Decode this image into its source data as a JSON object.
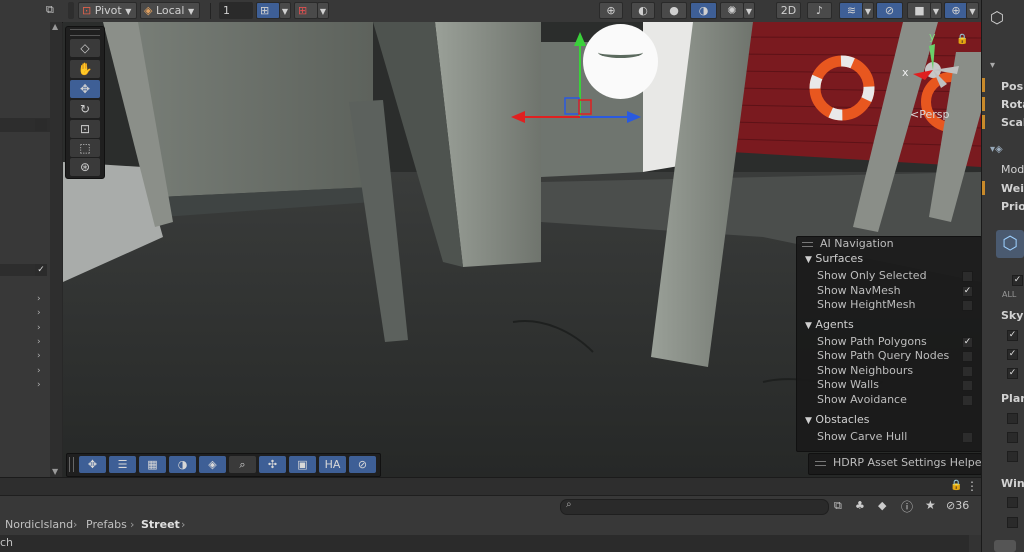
{
  "toolbar": {
    "pivot_label": "Pivot",
    "local_label": "Local",
    "grid_value": "1",
    "mode_2d": "2D"
  },
  "overlays": {
    "ai_navigation": {
      "title": "AI Navigation",
      "sections": [
        {
          "header": "Surfaces",
          "items": [
            {
              "label": "Show Only Selected",
              "checked": false
            },
            {
              "label": "Show NavMesh",
              "checked": true
            },
            {
              "label": "Show HeightMesh",
              "checked": false
            }
          ]
        },
        {
          "header": "Agents",
          "items": [
            {
              "label": "Show Path Polygons",
              "checked": true
            },
            {
              "label": "Show Path Query Nodes",
              "checked": false
            },
            {
              "label": "Show Neighbours",
              "checked": false
            },
            {
              "label": "Show Walls",
              "checked": false
            },
            {
              "label": "Show Avoidance",
              "checked": false
            }
          ]
        },
        {
          "header": "Obstacles",
          "items": [
            {
              "label": "Show Carve Hull",
              "checked": false
            }
          ]
        }
      ]
    },
    "hdrp_helper": {
      "title": "HDRP Asset Settings Helper"
    },
    "view_bar": {
      "ha_label": "HA"
    },
    "gizmo": {
      "persp_label": "<Persp",
      "x_label": "x",
      "y_label": "y"
    }
  },
  "breadcrumb": {
    "items": [
      "NordicIsland",
      "Prefabs",
      "Street"
    ]
  },
  "project_bar": {
    "hidden_count": "36"
  },
  "bottom_text": "ch",
  "inspector": {
    "labels": [
      "Posit",
      "Rota",
      "Scale",
      "Mod",
      "Weig",
      "Prior",
      "ALL",
      "Sky",
      "Plan",
      "Wind"
    ]
  },
  "colors": {
    "accent": "#3e5f96",
    "panel": "#383838",
    "barn_red": "#7a1a1f"
  }
}
